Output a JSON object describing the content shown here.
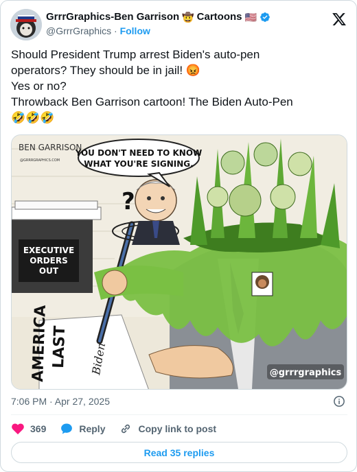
{
  "author": {
    "display_name": "GrrrGraphics-Ben Garrison",
    "emoji_cowboy": "🤠",
    "label_cartoons": "Cartoons",
    "emoji_flag": "🇺🇸",
    "handle": "@GrrrGraphics",
    "separator": "·",
    "follow_label": "Follow"
  },
  "tweet": {
    "lines": [
      "Should President Trump arrest Biden's auto-pen",
      "operators? They should be in jail! 😡",
      "Yes or no?",
      "Throwback Ben Garrison cartoon!  The Biden Auto-Pen",
      "🤣🤣🤣"
    ]
  },
  "media": {
    "signature": "BEN GARRISON",
    "signature_url": "@GRRRGRAPHICS.COM",
    "speech_line1": "YOU DON'T NEED TO KNOW",
    "speech_line2": "WHAT YOU'RE SIGNING.",
    "question_mark": "?",
    "sign_line1": "EXECUTIVE",
    "sign_line2": "ORDERS",
    "sign_line3": "OUT",
    "paper_line1": "AMERICA",
    "paper_line2": "LAST",
    "paper_signature": "Biden",
    "watermark": "@grrrgraphics"
  },
  "meta": {
    "timestamp": "7:06 PM · Apr 27, 2025"
  },
  "actions": {
    "likes": "369",
    "reply_label": "Reply",
    "copy_label": "Copy link to post"
  },
  "read_replies_label": "Read 35 replies",
  "colors": {
    "accent": "#1d9bf0",
    "like": "#f91880",
    "slime": "#7ac043",
    "text_secondary": "#536471"
  }
}
